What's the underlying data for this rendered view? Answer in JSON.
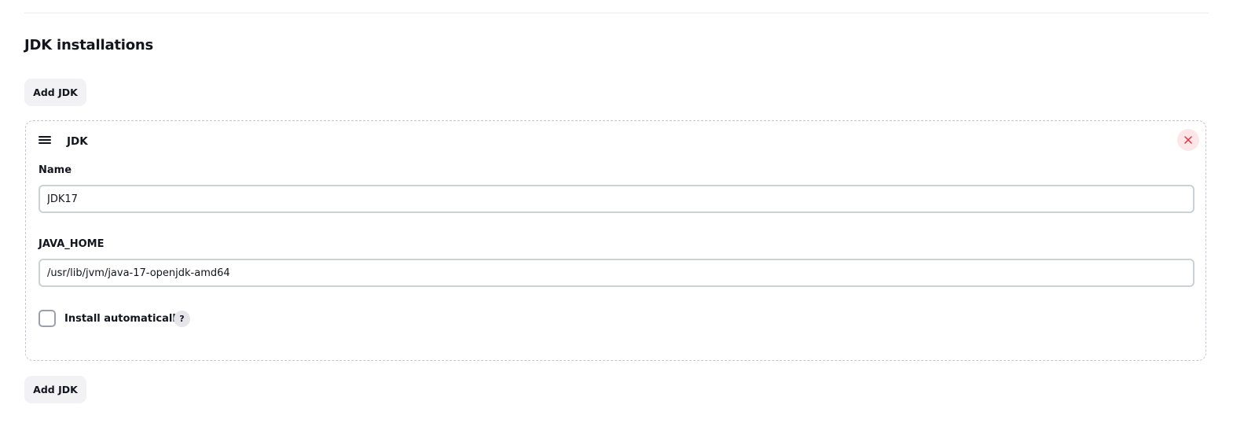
{
  "section": {
    "title": "JDK installations",
    "add_button_label": "Add JDK",
    "add_button_bottom_label": "Add JDK"
  },
  "jdk_card": {
    "title": "JDK",
    "drag_icon": "drag-handle-icon",
    "delete_icon": "close-icon",
    "delete_color": "#e5303f",
    "name_label": "Name",
    "name_value": "JDK17",
    "java_home_label": "JAVA_HOME",
    "java_home_value": "/usr/lib/jvm/java-17-openjdk-amd64",
    "install_auto_label": "Install automatically",
    "install_auto_checked": false,
    "help_label": "?"
  }
}
